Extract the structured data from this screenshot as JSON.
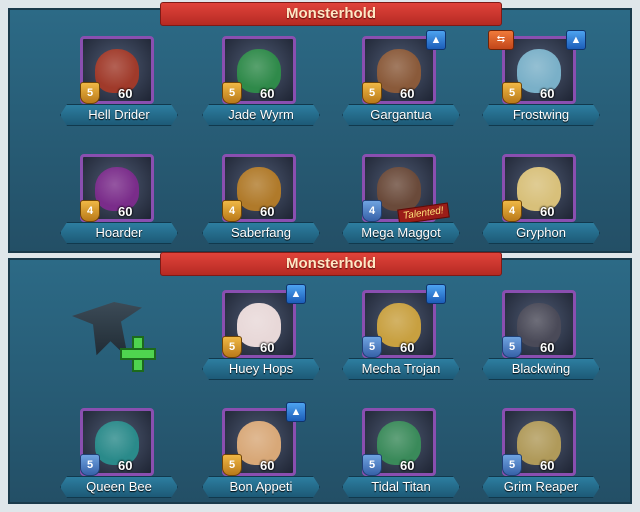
{
  "top_panel": {
    "title": "Monsterhold",
    "cards": [
      {
        "name": "Hell Drider",
        "tier": "5",
        "power": "60",
        "tier_color": "gold",
        "upgrade": false,
        "swap": false,
        "art": "#a03a2a"
      },
      {
        "name": "Jade Wyrm",
        "tier": "5",
        "power": "60",
        "tier_color": "gold",
        "upgrade": false,
        "swap": false,
        "art": "#2f8a4a"
      },
      {
        "name": "Gargantua",
        "tier": "5",
        "power": "60",
        "tier_color": "gold",
        "upgrade": true,
        "swap": false,
        "art": "#8a5a3a"
      },
      {
        "name": "Frostwing",
        "tier": "5",
        "power": "60",
        "tier_color": "gold",
        "upgrade": true,
        "swap": true,
        "art": "#7ab0c8"
      },
      {
        "name": "Hoarder",
        "tier": "4",
        "power": "60",
        "tier_color": "gold",
        "upgrade": false,
        "swap": false,
        "art": "#7a2c8a"
      },
      {
        "name": "Saberfang",
        "tier": "4",
        "power": "60",
        "tier_color": "gold",
        "upgrade": false,
        "swap": false,
        "art": "#b07a2a"
      },
      {
        "name": "Mega Maggot",
        "tier": "4",
        "power": "",
        "tier_color": "blue",
        "upgrade": false,
        "swap": false,
        "art": "#6a4a3a",
        "tag": "Talented!"
      },
      {
        "name": "Gryphon",
        "tier": "4",
        "power": "60",
        "tier_color": "gold",
        "upgrade": false,
        "swap": false,
        "art": "#d8c07a"
      }
    ]
  },
  "bottom_panel": {
    "title": "Monsterhold",
    "cards": [
      {
        "name": "Huey Hops",
        "tier": "5",
        "power": "60",
        "tier_color": "gold",
        "upgrade": true,
        "swap": false,
        "art": "#e8d8d8"
      },
      {
        "name": "Mecha Trojan",
        "tier": "5",
        "power": "60",
        "tier_color": "blue",
        "upgrade": true,
        "swap": false,
        "art": "#c8a040"
      },
      {
        "name": "Blackwing",
        "tier": "5",
        "power": "60",
        "tier_color": "blue",
        "upgrade": false,
        "swap": false,
        "art": "#4a4a58"
      },
      {
        "name": "Queen Bee",
        "tier": "5",
        "power": "60",
        "tier_color": "blue",
        "upgrade": false,
        "swap": false,
        "art": "#2a8a8a"
      },
      {
        "name": "Bon Appeti",
        "tier": "5",
        "power": "60",
        "tier_color": "gold",
        "upgrade": true,
        "swap": false,
        "art": "#d8a878"
      },
      {
        "name": "Tidal Titan",
        "tier": "5",
        "power": "60",
        "tier_color": "blue",
        "upgrade": false,
        "swap": false,
        "art": "#3a8a5a"
      },
      {
        "name": "Grim Reaper",
        "tier": "5",
        "power": "60",
        "tier_color": "blue",
        "upgrade": false,
        "swap": false,
        "art": "#b09a5a"
      }
    ]
  },
  "icons": {
    "upgrade": "arrow-up-icon",
    "swap": "swap-icon",
    "add": "add-monster-icon"
  },
  "colors": {
    "panel": "#2c6a86",
    "banner": "#d23a31",
    "name_plate": "#2d7ea0",
    "portrait_border": "#8a4fb0"
  }
}
